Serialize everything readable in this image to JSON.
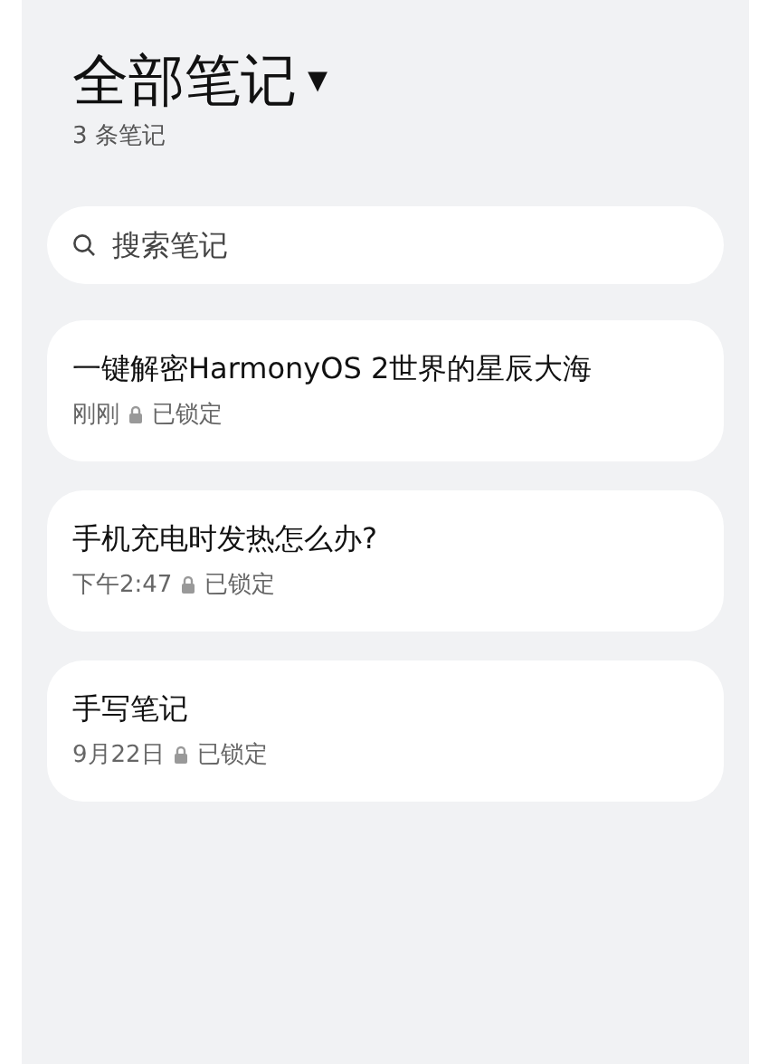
{
  "header": {
    "title": "全部笔记",
    "dropdown_arrow": "▾",
    "count": "3 条笔记"
  },
  "search": {
    "placeholder": "搜索笔记"
  },
  "notes": [
    {
      "title": "一键解密HarmonyOS 2世界的星辰大海",
      "time": "刚刚",
      "locked": true,
      "status": "已锁定"
    },
    {
      "title": "手机充电时发热怎么办?",
      "time": "下午2:47",
      "locked": true,
      "status": "已锁定"
    },
    {
      "title": "手写笔记",
      "time": "9月22日",
      "locked": true,
      "status": "已锁定"
    }
  ]
}
